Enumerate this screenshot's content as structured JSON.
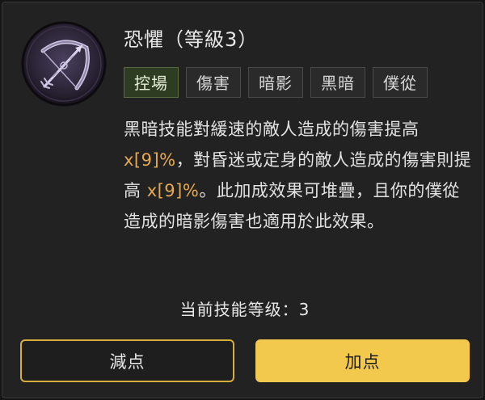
{
  "skill": {
    "title": "恐懼（等級3）",
    "icon": "bow-sigil-icon"
  },
  "tags": [
    {
      "label": "控場",
      "active": true
    },
    {
      "label": "傷害",
      "active": false
    },
    {
      "label": "暗影",
      "active": false
    },
    {
      "label": "黑暗",
      "active": false
    },
    {
      "label": "僕從",
      "active": false
    }
  ],
  "description": {
    "part1": "黑暗技能對緩速的敵人造成的傷害提高",
    "value1": "x[9]%",
    "part2": "，對昏迷或定身的敵人造成的傷害則提高",
    "value2": "x[9]%",
    "part3": "。此加成效果可堆疊，且你的僕從造成的暗影傷害也適用於此效果。"
  },
  "level_text": "当前技能等级：3",
  "buttons": {
    "minus_label": "減点",
    "plus_label": "加点"
  },
  "colors": {
    "highlight": "#e7a94f",
    "accent_yellow": "#f2c94c",
    "tag_active_bg": "#2e3c22"
  }
}
